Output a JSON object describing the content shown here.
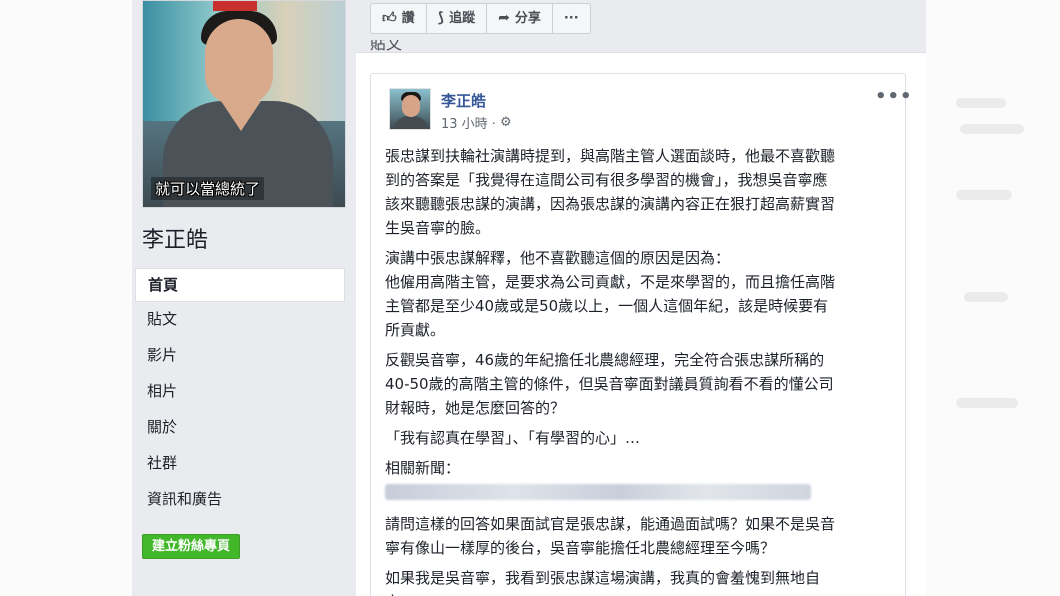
{
  "page": {
    "name": "李正皓",
    "photo_caption": "就可以當總統了"
  },
  "nav": {
    "items": [
      {
        "label": "首頁",
        "active": true
      },
      {
        "label": "貼文",
        "active": false
      },
      {
        "label": "影片",
        "active": false
      },
      {
        "label": "相片",
        "active": false
      },
      {
        "label": "關於",
        "active": false
      },
      {
        "label": "社群",
        "active": false
      },
      {
        "label": "資訊和廣告",
        "active": false
      }
    ],
    "create_button": "建立粉絲專頁"
  },
  "actions": {
    "like": "讚",
    "follow": "追蹤",
    "share": "分享",
    "more": "···"
  },
  "section_label": "貼文",
  "post": {
    "author": "李正皓",
    "time": "13 小時 ·",
    "more": "•••",
    "paragraphs": [
      [
        "張忠謀到扶輪社演講時提到，與高階主管人選面談時，他最不喜歡聽",
        "到的答案是「我覺得在這間公司有很多學習的機會」，我想吳音寧應",
        "該來聽聽張忠謀的演講，因為張忠謀的演講內容正在狠打超高薪實習",
        "生吳音寧的臉。"
      ],
      [
        "演講中張忠謀解釋，他不喜歡聽這個的原因是因為：",
        "他僱用高階主管，是要求為公司貢獻，不是來學習的，而且擔任高階",
        "主管都是至少40歲或是50歲以上，一個人這個年紀，該是時候要有",
        "所貢獻。"
      ],
      [
        "反觀吳音寧，46歲的年紀擔任北農總經理，完全符合張忠謀所稱的",
        "40-50歲的高階主管的條件，但吳音寧面對議員質詢看不看的懂公司",
        "財報時，她是怎麼回答的？"
      ],
      [
        "「我有認真在學習」、「有學習的心」…"
      ],
      [
        "相關新聞："
      ]
    ],
    "paragraphs_after": [
      [
        "請問這樣的回答如果面試官是張忠謀，能通過面試嗎？如果不是吳音",
        "寧有像山一樣厚的後台，吳音寧能擔任北農總經理至今嗎？"
      ],
      [
        "如果我是吳音寧，我看到張忠謀這場演講，我真的會羞愧到無地自",
        "容。"
      ]
    ]
  },
  "icons": {
    "like": "thumbs-up-icon",
    "follow": "rss-follow-icon",
    "share": "share-arrow-icon",
    "gear": "gear-icon"
  }
}
